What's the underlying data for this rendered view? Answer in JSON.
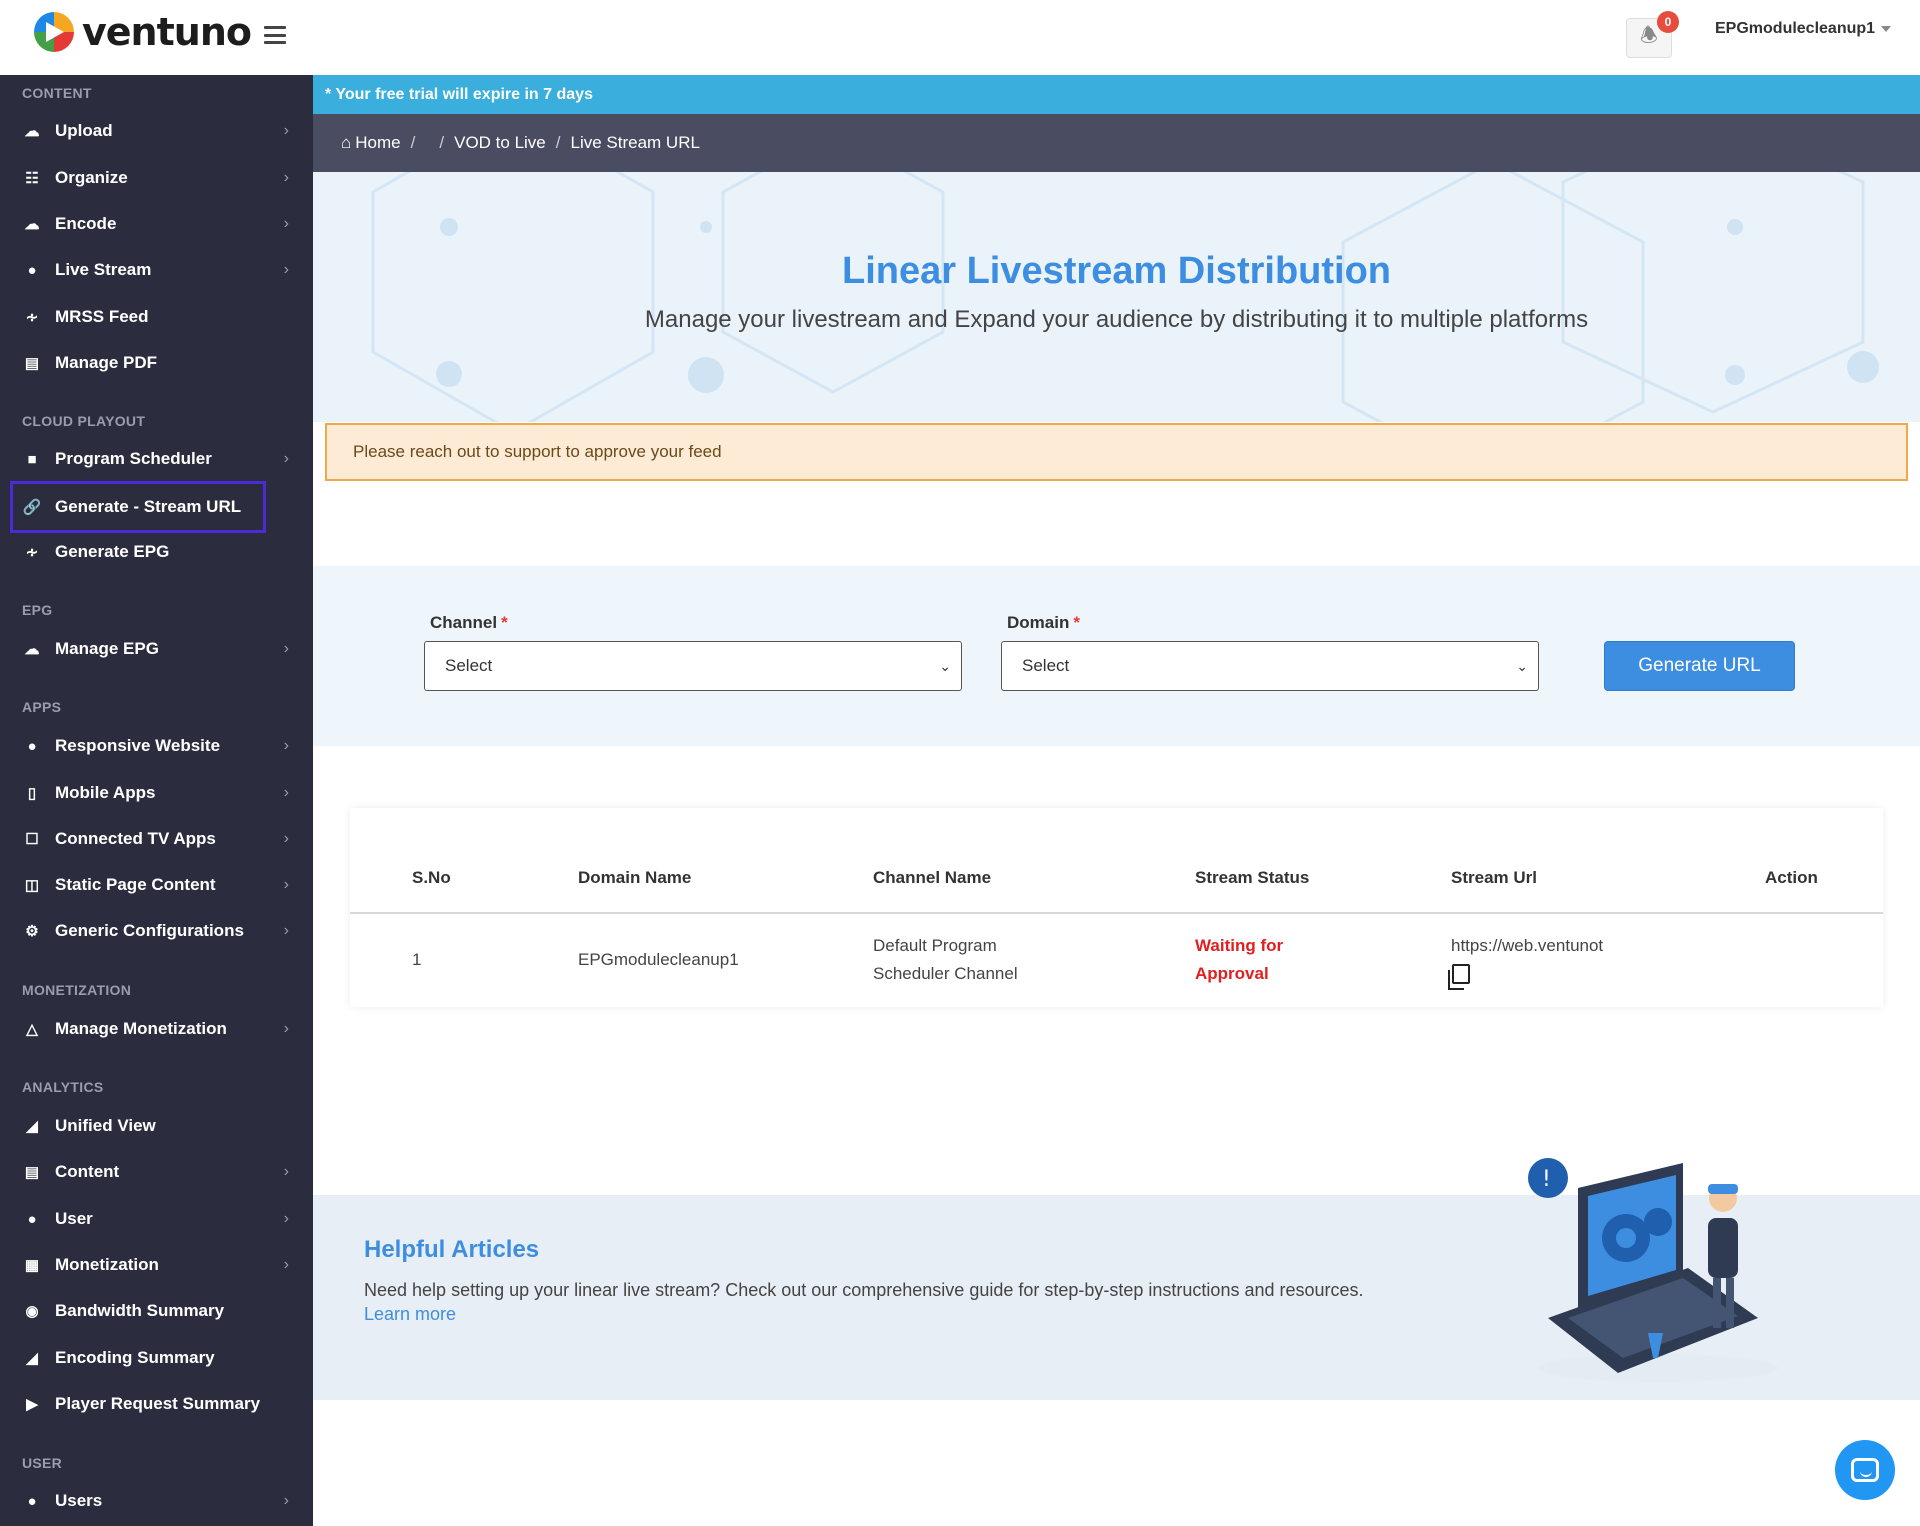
{
  "brand": {
    "name": "ventuno"
  },
  "header": {
    "notification_count": "0",
    "username": "EPGmodulecleanup1"
  },
  "sidebar": {
    "sections": [
      {
        "title": "CONTENT",
        "items": [
          {
            "label": "Upload",
            "icon": "cloud-upload-icon",
            "chevron": true
          },
          {
            "label": "Organize",
            "icon": "sitemap-icon",
            "chevron": true
          },
          {
            "label": "Encode",
            "icon": "cloud-gear-icon",
            "chevron": true
          },
          {
            "label": "Live Stream",
            "icon": "globe-icon",
            "chevron": true
          },
          {
            "label": "MRSS Feed",
            "icon": "rss-icon",
            "chevron": false
          },
          {
            "label": "Manage PDF",
            "icon": "pdf-file-icon",
            "chevron": false
          }
        ]
      },
      {
        "title": "CLOUD PLAYOUT",
        "items": [
          {
            "label": "Program Scheduler",
            "icon": "video-camera-icon",
            "chevron": true
          },
          {
            "label": "Generate - Stream URL",
            "icon": "link-icon",
            "chevron": false,
            "active": true
          },
          {
            "label": "Generate EPG",
            "icon": "rss-icon",
            "chevron": false
          }
        ]
      },
      {
        "title": "EPG",
        "items": [
          {
            "label": "Manage EPG",
            "icon": "cloud-upload-icon",
            "chevron": true
          }
        ]
      },
      {
        "title": "APPS",
        "items": [
          {
            "label": "Responsive Website",
            "icon": "globe-icon",
            "chevron": true
          },
          {
            "label": "Mobile Apps",
            "icon": "mobile-icon",
            "chevron": true
          },
          {
            "label": "Connected TV Apps",
            "icon": "tv-icon",
            "chevron": true
          },
          {
            "label": "Static Page Content",
            "icon": "columns-icon",
            "chevron": true
          },
          {
            "label": "Generic Configurations",
            "icon": "gear-icon",
            "chevron": true
          }
        ]
      },
      {
        "title": "MONETIZATION",
        "items": [
          {
            "label": "Manage Monetization",
            "icon": "fire-icon",
            "chevron": true
          }
        ]
      },
      {
        "title": "ANALYTICS",
        "items": [
          {
            "label": "Unified View",
            "icon": "area-chart-icon",
            "chevron": false
          },
          {
            "label": "Content",
            "icon": "file-chart-icon",
            "chevron": true
          },
          {
            "label": "User",
            "icon": "user-icon",
            "chevron": true
          },
          {
            "label": "Monetization",
            "icon": "edit-square-icon",
            "chevron": true
          },
          {
            "label": "Bandwidth Summary",
            "icon": "broadcast-icon",
            "chevron": false
          },
          {
            "label": "Encoding Summary",
            "icon": "area-chart-icon",
            "chevron": false
          },
          {
            "label": "Player Request Summary",
            "icon": "play-circle-icon",
            "chevron": false
          }
        ]
      },
      {
        "title": "USER",
        "items": [
          {
            "label": "Users",
            "icon": "users-icon",
            "chevron": true
          }
        ]
      }
    ]
  },
  "trial_banner": "* Your free trial will expire in 7 days",
  "breadcrumb": {
    "home": "Home",
    "sep": "/",
    "parent": "VOD to Live",
    "current": "Live Stream URL"
  },
  "hero": {
    "title": "Linear Livestream Distribution",
    "subtitle": "Manage your livestream and Expand your audience by distributing it to multiple platforms"
  },
  "alert": "Please reach out to support to approve your feed",
  "form": {
    "channel_label": "Channel",
    "domain_label": "Domain",
    "required_mark": "*",
    "channel_value": "Select",
    "domain_value": "Select",
    "generate_label": "Generate URL"
  },
  "table": {
    "headers": [
      "S.No",
      "Domain Name",
      "Channel Name",
      "Stream Status",
      "Stream Url",
      "Action"
    ],
    "rows": [
      {
        "sno": "1",
        "domain": "EPGmodulecleanup1",
        "channel_line1": "Default Program",
        "channel_line2": "Scheduler Channel",
        "status_line1": "Waiting for",
        "status_line2": "Approval",
        "url": "https://web.ventunot"
      }
    ]
  },
  "help": {
    "title": "Helpful Articles",
    "text": "Need help setting up your linear live stream? Check out our comprehensive guide for step-by-step instructions and resources.",
    "link": "Learn more"
  },
  "colors": {
    "accent": "#3d8ee0",
    "sidebar_bg": "#2b2d3e",
    "trial_bg": "#3aaedc",
    "status_red": "#e02020"
  }
}
